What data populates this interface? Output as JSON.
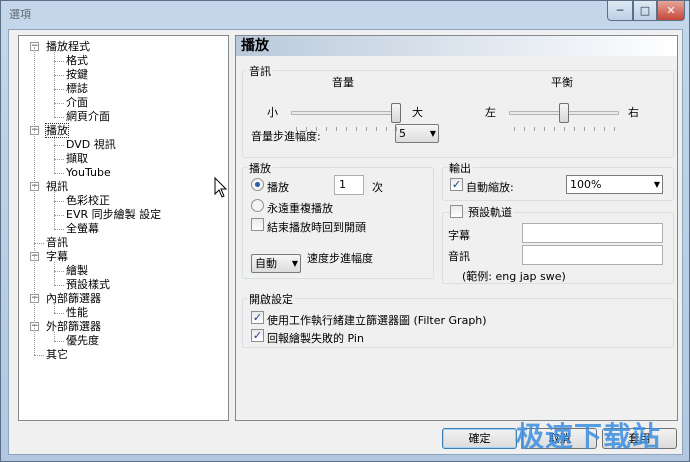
{
  "window": {
    "title": "選項",
    "min": "─",
    "max": "□",
    "close": "✕"
  },
  "tree": {
    "items": [
      {
        "label": "播放程式",
        "level": 0
      },
      {
        "label": "格式",
        "level": 1
      },
      {
        "label": "按鍵",
        "level": 1
      },
      {
        "label": "標誌",
        "level": 1
      },
      {
        "label": "介面",
        "level": 1
      },
      {
        "label": "網頁介面",
        "level": 1
      },
      {
        "label": "播放",
        "level": 0
      },
      {
        "label": "DVD 視訊",
        "level": 1
      },
      {
        "label": "擷取",
        "level": 1
      },
      {
        "label": "YouTube",
        "level": 1
      },
      {
        "label": "視訊",
        "level": 0
      },
      {
        "label": "色彩校正",
        "level": 1
      },
      {
        "label": "EVR 同步繪製 設定",
        "level": 1
      },
      {
        "label": "全螢幕",
        "level": 1
      },
      {
        "label": "音訊",
        "level": 0
      },
      {
        "label": "字幕",
        "level": 0
      },
      {
        "label": "繪製",
        "level": 1
      },
      {
        "label": "預設樣式",
        "level": 1
      },
      {
        "label": "內部篩選器",
        "level": 0
      },
      {
        "label": "性能",
        "level": 1
      },
      {
        "label": "外部篩選器",
        "level": 0
      },
      {
        "label": "優先度",
        "level": 1
      },
      {
        "label": "其它",
        "level": 0
      }
    ]
  },
  "panel": {
    "title": "播放",
    "audio": {
      "legend": "音訊",
      "volume_label": "音量",
      "balance_label": "平衡",
      "min_label": "小",
      "max_label": "大",
      "left_label": "左",
      "right_label": "右",
      "step_label": "音量步進幅度:",
      "step_value": "5",
      "volume_level": 1.0,
      "balance_level": 0.5
    },
    "playback": {
      "legend": "播放",
      "play_label": "播放",
      "play_count": "1",
      "times_label": "次",
      "repeat_label": "永遠重複播放",
      "rewind_label": "結束播放時回到開頭",
      "speed_value": "自動",
      "speed_label": "速度步進幅度"
    },
    "output": {
      "legend": "輸出",
      "autozoom_label": "自動縮放:",
      "autozoom_value": "100%"
    },
    "tracks": {
      "legend": "預設軌道",
      "subtitle_label": "字幕",
      "audio_label": "音訊",
      "example": "(範例: eng jap swe)"
    },
    "open": {
      "legend": "開啟設定",
      "worker_label": "使用工作執行緒建立篩選器圖 (Filter Graph)",
      "report_label": "回報繪製失敗的 Pin"
    }
  },
  "buttons": {
    "ok": "確定",
    "cancel": "取消",
    "apply": "套用"
  },
  "watermark": "极速下载站",
  "colors": {
    "accent": "#3c7fb1",
    "check": "#1a3a8a"
  }
}
